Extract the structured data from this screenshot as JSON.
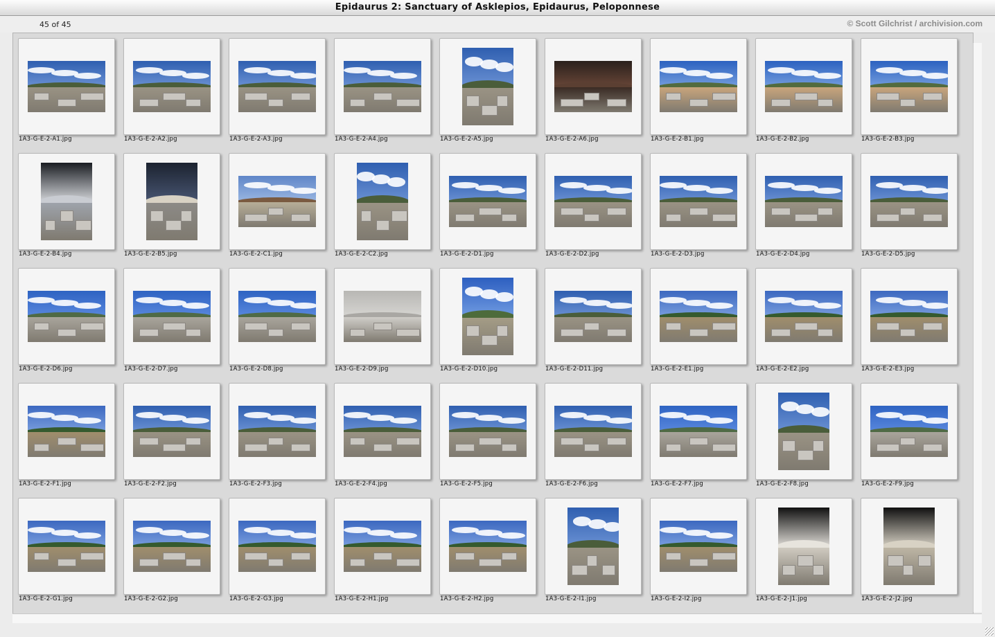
{
  "window": {
    "title": "Epidaurus 2: Sanctuary of Asklepios, Epidaurus, Peloponnese"
  },
  "header": {
    "counter": "45 of 45",
    "copyright": "© Scott Gilchrist / archivision.com"
  },
  "slides": [
    {
      "file": "1A3-G-E-2-A1.jpg",
      "orientation": "landscape",
      "scene": "ruins-sky"
    },
    {
      "file": "1A3-G-E-2-A2.jpg",
      "orientation": "landscape",
      "scene": "ruins-sky"
    },
    {
      "file": "1A3-G-E-2-A3.jpg",
      "orientation": "landscape",
      "scene": "ruins-sky"
    },
    {
      "file": "1A3-G-E-2-A4.jpg",
      "orientation": "landscape",
      "scene": "ruins-sky"
    },
    {
      "file": "1A3-G-E-2-A5.jpg",
      "orientation": "portrait",
      "scene": "ruins-sky"
    },
    {
      "file": "1A3-G-E-2-A6.jpg",
      "orientation": "landscape",
      "scene": "interior"
    },
    {
      "file": "1A3-G-E-2-B1.jpg",
      "orientation": "landscape",
      "scene": "circle"
    },
    {
      "file": "1A3-G-E-2-B2.jpg",
      "orientation": "landscape",
      "scene": "circle"
    },
    {
      "file": "1A3-G-E-2-B3.jpg",
      "orientation": "landscape",
      "scene": "circle"
    },
    {
      "file": "1A3-G-E-2-B4.jpg",
      "orientation": "portrait",
      "scene": "coffer"
    },
    {
      "file": "1A3-G-E-2-B5.jpg",
      "orientation": "portrait",
      "scene": "capital"
    },
    {
      "file": "1A3-G-E-2-C1.jpg",
      "orientation": "landscape",
      "scene": "shelter"
    },
    {
      "file": "1A3-G-E-2-C2.jpg",
      "orientation": "portrait",
      "scene": "ruins-sky"
    },
    {
      "file": "1A3-G-E-2-D1.jpg",
      "orientation": "landscape",
      "scene": "ruins-sky"
    },
    {
      "file": "1A3-G-E-2-D2.jpg",
      "orientation": "landscape",
      "scene": "ruins-sky"
    },
    {
      "file": "1A3-G-E-2-D3.jpg",
      "orientation": "landscape",
      "scene": "ruins-sky"
    },
    {
      "file": "1A3-G-E-2-D4.jpg",
      "orientation": "landscape",
      "scene": "ruins-sky"
    },
    {
      "file": "1A3-G-E-2-D5.jpg",
      "orientation": "landscape",
      "scene": "ruins-sky"
    },
    {
      "file": "1A3-G-E-2-D6.jpg",
      "orientation": "landscape",
      "scene": "blocks"
    },
    {
      "file": "1A3-G-E-2-D7.jpg",
      "orientation": "landscape",
      "scene": "blocks"
    },
    {
      "file": "1A3-G-E-2-D8.jpg",
      "orientation": "landscape",
      "scene": "blocks"
    },
    {
      "file": "1A3-G-E-2-D9.jpg",
      "orientation": "landscape",
      "scene": "wall"
    },
    {
      "file": "1A3-G-E-2-D10.jpg",
      "orientation": "portrait",
      "scene": "pillar"
    },
    {
      "file": "1A3-G-E-2-D11.jpg",
      "orientation": "landscape",
      "scene": "ruins-sky"
    },
    {
      "file": "1A3-G-E-2-E1.jpg",
      "orientation": "landscape",
      "scene": "field"
    },
    {
      "file": "1A3-G-E-2-E2.jpg",
      "orientation": "landscape",
      "scene": "field"
    },
    {
      "file": "1A3-G-E-2-E3.jpg",
      "orientation": "landscape",
      "scene": "field"
    },
    {
      "file": "1A3-G-E-2-F1.jpg",
      "orientation": "landscape",
      "scene": "field"
    },
    {
      "file": "1A3-G-E-2-F2.jpg",
      "orientation": "landscape",
      "scene": "ruins-sky"
    },
    {
      "file": "1A3-G-E-2-F3.jpg",
      "orientation": "landscape",
      "scene": "ruins-sky"
    },
    {
      "file": "1A3-G-E-2-F4.jpg",
      "orientation": "landscape",
      "scene": "ruins-sky"
    },
    {
      "file": "1A3-G-E-2-F5.jpg",
      "orientation": "landscape",
      "scene": "ruins-sky"
    },
    {
      "file": "1A3-G-E-2-F6.jpg",
      "orientation": "landscape",
      "scene": "ruins-sky"
    },
    {
      "file": "1A3-G-E-2-F7.jpg",
      "orientation": "landscape",
      "scene": "blocks"
    },
    {
      "file": "1A3-G-E-2-F8.jpg",
      "orientation": "portrait",
      "scene": "ruins-sky"
    },
    {
      "file": "1A3-G-E-2-F9.jpg",
      "orientation": "landscape",
      "scene": "blocks"
    },
    {
      "file": "1A3-G-E-2-G1.jpg",
      "orientation": "landscape",
      "scene": "field"
    },
    {
      "file": "1A3-G-E-2-G2.jpg",
      "orientation": "landscape",
      "scene": "field"
    },
    {
      "file": "1A3-G-E-2-G3.jpg",
      "orientation": "landscape",
      "scene": "field"
    },
    {
      "file": "1A3-G-E-2-H1.jpg",
      "orientation": "landscape",
      "scene": "field"
    },
    {
      "file": "1A3-G-E-2-H2.jpg",
      "orientation": "landscape",
      "scene": "field"
    },
    {
      "file": "1A3-G-E-2-I1.jpg",
      "orientation": "portrait",
      "scene": "ruins-sky"
    },
    {
      "file": "1A3-G-E-2-I2.jpg",
      "orientation": "landscape",
      "scene": "field"
    },
    {
      "file": "1A3-G-E-2-J1.jpg",
      "orientation": "portrait",
      "scene": "statue"
    },
    {
      "file": "1A3-G-E-2-J2.jpg",
      "orientation": "portrait",
      "scene": "relief"
    }
  ]
}
